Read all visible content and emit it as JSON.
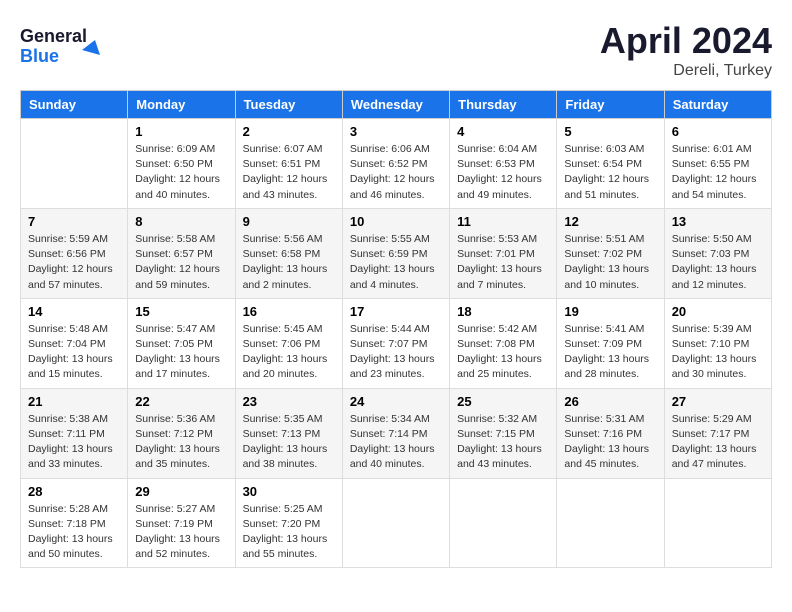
{
  "header": {
    "logo_line1": "General",
    "logo_line2": "Blue",
    "month": "April 2024",
    "location": "Dereli, Turkey"
  },
  "weekdays": [
    "Sunday",
    "Monday",
    "Tuesday",
    "Wednesday",
    "Thursday",
    "Friday",
    "Saturday"
  ],
  "weeks": [
    [
      {
        "day": "",
        "info": ""
      },
      {
        "day": "1",
        "info": "Sunrise: 6:09 AM\nSunset: 6:50 PM\nDaylight: 12 hours\nand 40 minutes."
      },
      {
        "day": "2",
        "info": "Sunrise: 6:07 AM\nSunset: 6:51 PM\nDaylight: 12 hours\nand 43 minutes."
      },
      {
        "day": "3",
        "info": "Sunrise: 6:06 AM\nSunset: 6:52 PM\nDaylight: 12 hours\nand 46 minutes."
      },
      {
        "day": "4",
        "info": "Sunrise: 6:04 AM\nSunset: 6:53 PM\nDaylight: 12 hours\nand 49 minutes."
      },
      {
        "day": "5",
        "info": "Sunrise: 6:03 AM\nSunset: 6:54 PM\nDaylight: 12 hours\nand 51 minutes."
      },
      {
        "day": "6",
        "info": "Sunrise: 6:01 AM\nSunset: 6:55 PM\nDaylight: 12 hours\nand 54 minutes."
      }
    ],
    [
      {
        "day": "7",
        "info": "Sunrise: 5:59 AM\nSunset: 6:56 PM\nDaylight: 12 hours\nand 57 minutes."
      },
      {
        "day": "8",
        "info": "Sunrise: 5:58 AM\nSunset: 6:57 PM\nDaylight: 12 hours\nand 59 minutes."
      },
      {
        "day": "9",
        "info": "Sunrise: 5:56 AM\nSunset: 6:58 PM\nDaylight: 13 hours\nand 2 minutes."
      },
      {
        "day": "10",
        "info": "Sunrise: 5:55 AM\nSunset: 6:59 PM\nDaylight: 13 hours\nand 4 minutes."
      },
      {
        "day": "11",
        "info": "Sunrise: 5:53 AM\nSunset: 7:01 PM\nDaylight: 13 hours\nand 7 minutes."
      },
      {
        "day": "12",
        "info": "Sunrise: 5:51 AM\nSunset: 7:02 PM\nDaylight: 13 hours\nand 10 minutes."
      },
      {
        "day": "13",
        "info": "Sunrise: 5:50 AM\nSunset: 7:03 PM\nDaylight: 13 hours\nand 12 minutes."
      }
    ],
    [
      {
        "day": "14",
        "info": "Sunrise: 5:48 AM\nSunset: 7:04 PM\nDaylight: 13 hours\nand 15 minutes."
      },
      {
        "day": "15",
        "info": "Sunrise: 5:47 AM\nSunset: 7:05 PM\nDaylight: 13 hours\nand 17 minutes."
      },
      {
        "day": "16",
        "info": "Sunrise: 5:45 AM\nSunset: 7:06 PM\nDaylight: 13 hours\nand 20 minutes."
      },
      {
        "day": "17",
        "info": "Sunrise: 5:44 AM\nSunset: 7:07 PM\nDaylight: 13 hours\nand 23 minutes."
      },
      {
        "day": "18",
        "info": "Sunrise: 5:42 AM\nSunset: 7:08 PM\nDaylight: 13 hours\nand 25 minutes."
      },
      {
        "day": "19",
        "info": "Sunrise: 5:41 AM\nSunset: 7:09 PM\nDaylight: 13 hours\nand 28 minutes."
      },
      {
        "day": "20",
        "info": "Sunrise: 5:39 AM\nSunset: 7:10 PM\nDaylight: 13 hours\nand 30 minutes."
      }
    ],
    [
      {
        "day": "21",
        "info": "Sunrise: 5:38 AM\nSunset: 7:11 PM\nDaylight: 13 hours\nand 33 minutes."
      },
      {
        "day": "22",
        "info": "Sunrise: 5:36 AM\nSunset: 7:12 PM\nDaylight: 13 hours\nand 35 minutes."
      },
      {
        "day": "23",
        "info": "Sunrise: 5:35 AM\nSunset: 7:13 PM\nDaylight: 13 hours\nand 38 minutes."
      },
      {
        "day": "24",
        "info": "Sunrise: 5:34 AM\nSunset: 7:14 PM\nDaylight: 13 hours\nand 40 minutes."
      },
      {
        "day": "25",
        "info": "Sunrise: 5:32 AM\nSunset: 7:15 PM\nDaylight: 13 hours\nand 43 minutes."
      },
      {
        "day": "26",
        "info": "Sunrise: 5:31 AM\nSunset: 7:16 PM\nDaylight: 13 hours\nand 45 minutes."
      },
      {
        "day": "27",
        "info": "Sunrise: 5:29 AM\nSunset: 7:17 PM\nDaylight: 13 hours\nand 47 minutes."
      }
    ],
    [
      {
        "day": "28",
        "info": "Sunrise: 5:28 AM\nSunset: 7:18 PM\nDaylight: 13 hours\nand 50 minutes."
      },
      {
        "day": "29",
        "info": "Sunrise: 5:27 AM\nSunset: 7:19 PM\nDaylight: 13 hours\nand 52 minutes."
      },
      {
        "day": "30",
        "info": "Sunrise: 5:25 AM\nSunset: 7:20 PM\nDaylight: 13 hours\nand 55 minutes."
      },
      {
        "day": "",
        "info": ""
      },
      {
        "day": "",
        "info": ""
      },
      {
        "day": "",
        "info": ""
      },
      {
        "day": "",
        "info": ""
      }
    ]
  ]
}
